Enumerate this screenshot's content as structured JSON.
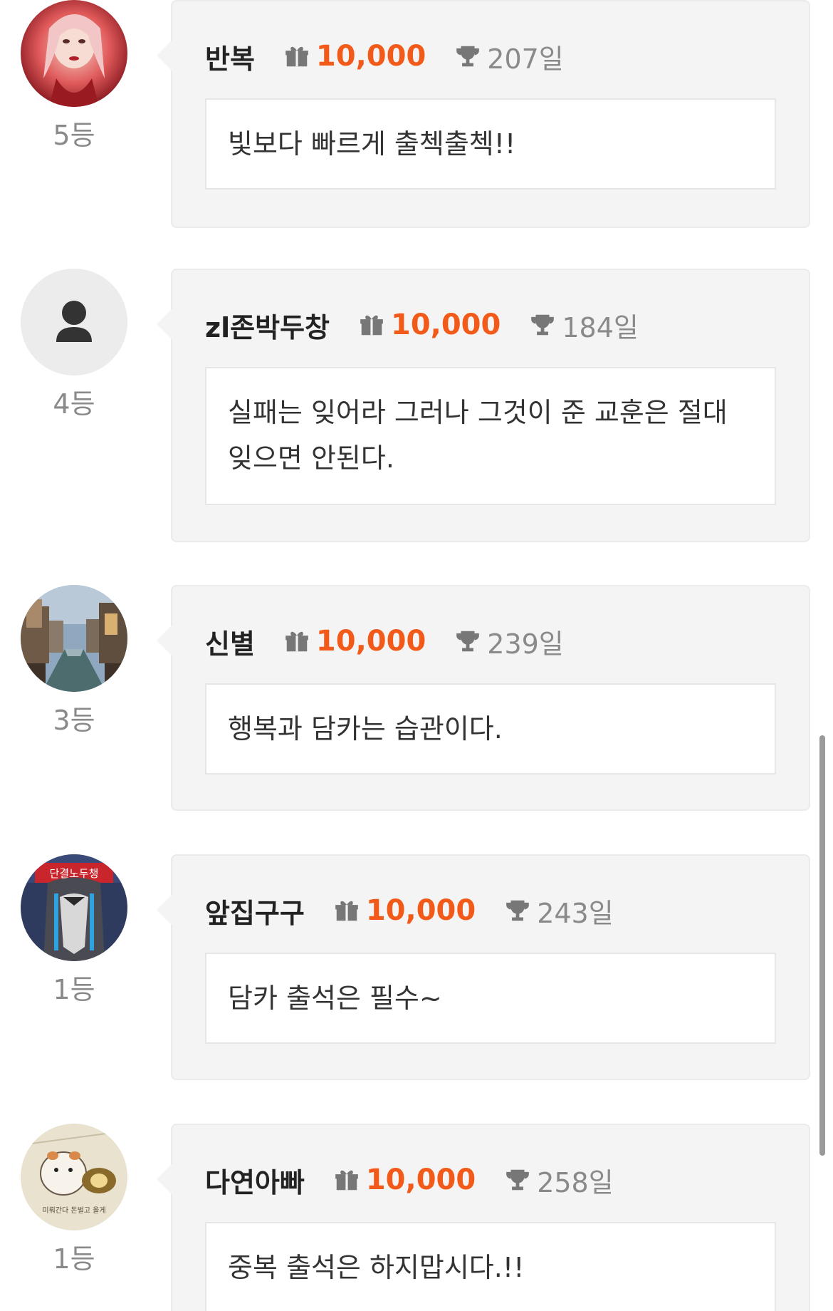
{
  "colors": {
    "accent_points": "#f25a1a",
    "card_bg": "#f4f4f4",
    "rank_text": "#8a8a8a"
  },
  "entries": [
    {
      "rank": "5등",
      "nickname": "반복",
      "points": "10,000",
      "days": "207일",
      "comment": "빛보다 빠르게 출첵출첵!!",
      "avatar": "portrait-avatar"
    },
    {
      "rank": "4등",
      "nickname": "zl존박두창",
      "points": "10,000",
      "days": "184일",
      "comment": "실패는 잊어라 그러나 그것이 준 교훈은 절대 잊으면 안된다.",
      "avatar": "default-user-icon"
    },
    {
      "rank": "3등",
      "nickname": "신별",
      "points": "10,000",
      "days": "239일",
      "comment": "행복과 담카는 습관이다.",
      "avatar": "canal-city-avatar"
    },
    {
      "rank": "1등",
      "nickname": "앞집구구",
      "points": "10,000",
      "days": "243일",
      "comment": "담카 출석은 필수~",
      "avatar": "crying-cartoon-avatar",
      "avatar_text": "단결노두챙"
    },
    {
      "rank": "1등",
      "nickname": "다연아빠",
      "points": "10,000",
      "days": "258일",
      "comment": "중복 출석은 하지맙시다.!!",
      "avatar": "hamster-cartoon-avatar",
      "avatar_text": "미뤄간다 돈벌고 올게"
    }
  ]
}
